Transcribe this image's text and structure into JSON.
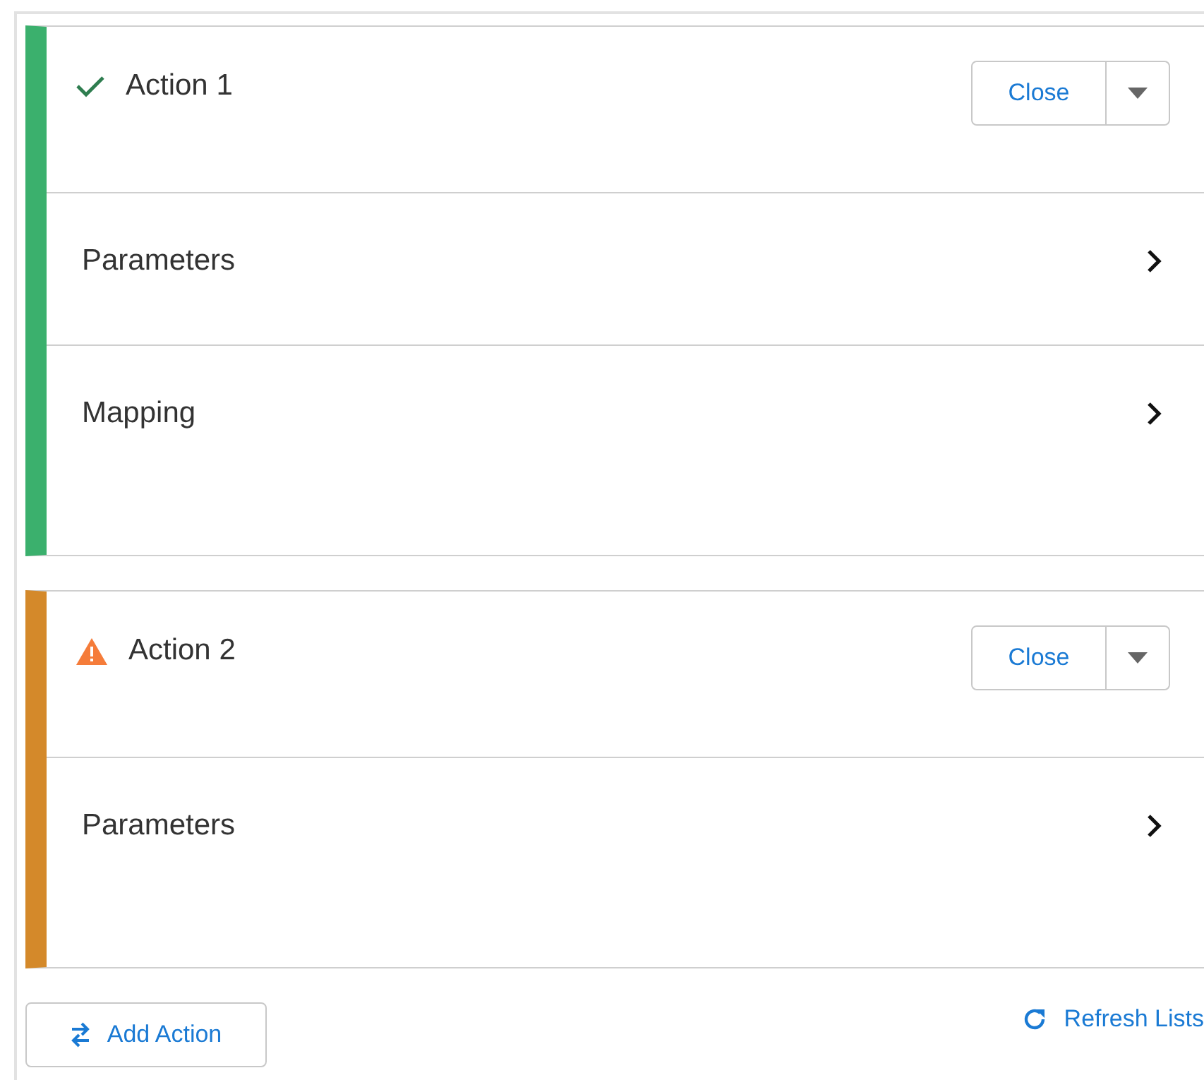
{
  "actions": [
    {
      "title": "Action 1",
      "kind": "success",
      "color": "#3bb06d",
      "close_label": "Close",
      "sections": [
        {
          "label": "Parameters",
          "tall": false
        },
        {
          "label": "Mapping",
          "tall": true
        }
      ]
    },
    {
      "title": "Action 2",
      "kind": "warning",
      "color": "#d4892a",
      "close_label": "Close",
      "sections": [
        {
          "label": "Parameters",
          "tall": true
        }
      ]
    }
  ],
  "footer": {
    "add_label": "Add Action",
    "refresh_label": "Refresh Lists"
  }
}
